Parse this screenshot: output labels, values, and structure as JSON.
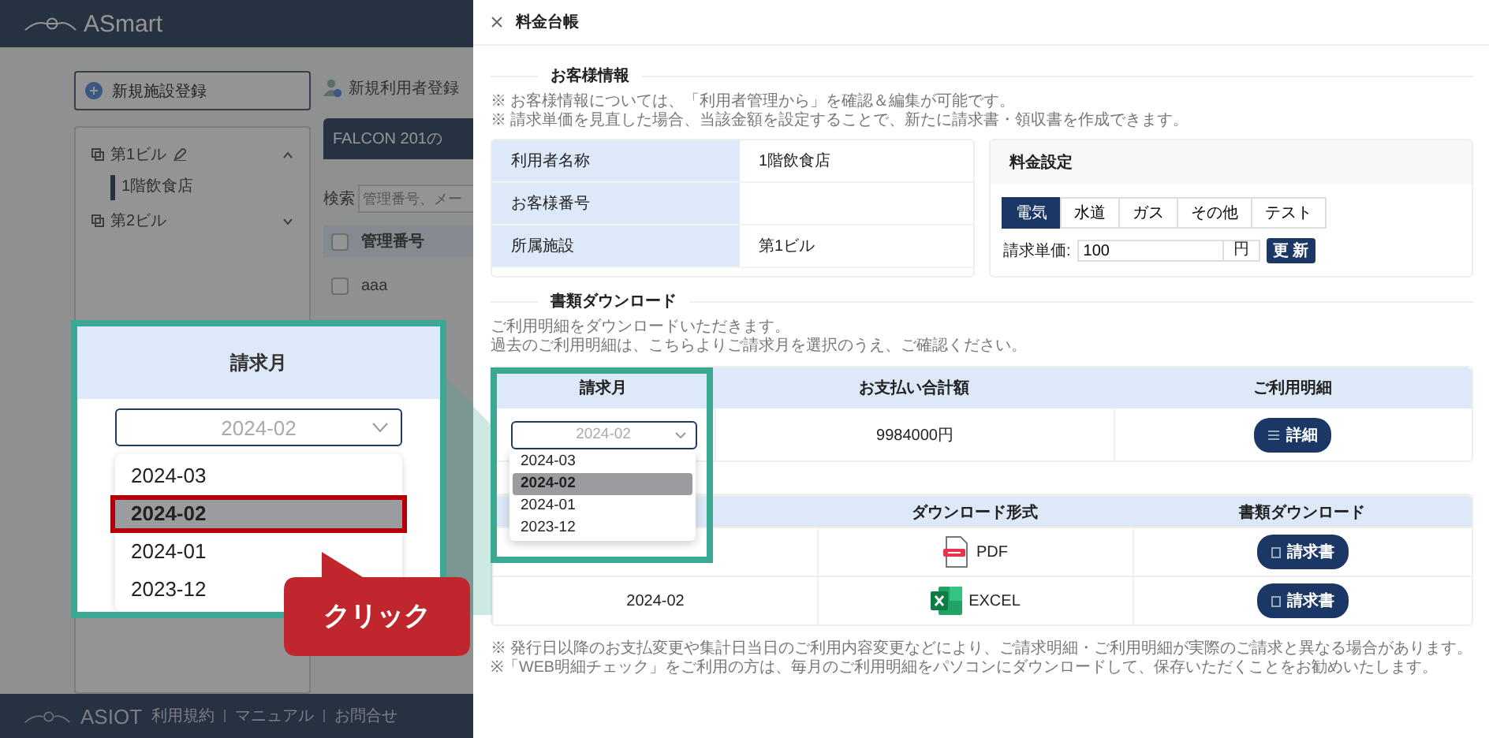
{
  "app": {
    "logo": "ASmart",
    "add_facility_button": "新規施設登録",
    "add_user_button": "新規利用者登録",
    "tree": [
      {
        "label": "第1ビル",
        "expanded": true,
        "children": [
          {
            "label": "1階飲食店",
            "selected": true
          }
        ]
      },
      {
        "label": "第2ビル",
        "expanded": false
      }
    ],
    "tab": "FALCON 201の",
    "search_label": "検索",
    "search_placeholder": "管理番号、メー",
    "table_column": "管理番号",
    "header_checked": false,
    "rows": [
      {
        "id": "aaa",
        "checked": false
      }
    ],
    "footer_logo": "ASIOT",
    "footer_links": [
      "利用規約",
      "マニュアル",
      "お問合せ"
    ]
  },
  "drawer": {
    "title": "料金台帳",
    "customer_section": {
      "heading": "お客様情報",
      "notes": [
        "※ お客様情報については、「利用者管理から」を確認＆編集が可能です。",
        "※ 請求単価を見直した場合、当該金額を設定することで、新たに請求書・領収書を作成できます。"
      ],
      "fields": [
        {
          "label": "利用者名称",
          "value": "1階飲食店"
        },
        {
          "label": "お客様番号"
        },
        {
          "label": "所属施設",
          "value": "第1ビル"
        }
      ]
    },
    "rate_settings": {
      "title": "料金設定",
      "tabs": [
        {
          "label": "電気",
          "selected": true
        },
        {
          "label": "水道",
          "selected": false
        },
        {
          "label": "ガス",
          "selected": false
        },
        {
          "label": "その他",
          "selected": false
        },
        {
          "label": "テスト",
          "selected": false
        }
      ],
      "unit_price_label": "請求単価:",
      "unit_price": "100",
      "unit": "円",
      "update_button": "更 新"
    },
    "download_section": {
      "heading": "書類ダウンロード",
      "notes": [
        "ご利用明細をダウンロードいただきます。",
        "過去のご利用明細は、こちらよりご請求月を選択のうえ、ご確認ください。"
      ],
      "summary_table": {
        "columns": [
          "請求月",
          "お支払い合計額",
          "ご利用明細"
        ],
        "month_select": {
          "value": "2024-02",
          "options": [
            {
              "label": "2024-03",
              "selected": false
            },
            {
              "label": "2024-02",
              "selected": true
            },
            {
              "label": "2024-01",
              "selected": false
            },
            {
              "label": "2023-12",
              "selected": false
            }
          ]
        },
        "total": "9984000円",
        "detail_button": "詳細"
      },
      "documents_table": {
        "columns": [
          "ダウンロード形式",
          "書類ダウンロード"
        ],
        "rows": [
          {
            "kind": "pdf",
            "format": "PDF",
            "button": "請求書"
          },
          {
            "kind": "excel",
            "month": "2024-02",
            "format": "EXCEL",
            "button": "請求書"
          }
        ]
      }
    },
    "footer_notes": [
      "※ 発行日以降のお支払変更や集計日当日のご利用内容変更などにより、ご請求明細・ご利用明細が実際のご請求と異なる場合があります。",
      "※「WEB明細チェック」をご利用の方は、毎月のご利用明細をパソコンにダウンロードして、保存いただくことをお勧めいたします。"
    ]
  },
  "callout": {
    "header": "請求月",
    "select_value": "2024-02",
    "options": [
      {
        "label": "2024-03",
        "selected": false
      },
      {
        "label": "2024-02",
        "selected": true
      },
      {
        "label": "2024-01",
        "selected": false
      },
      {
        "label": "2023-12",
        "selected": false
      }
    ],
    "click_label": "クリック"
  }
}
